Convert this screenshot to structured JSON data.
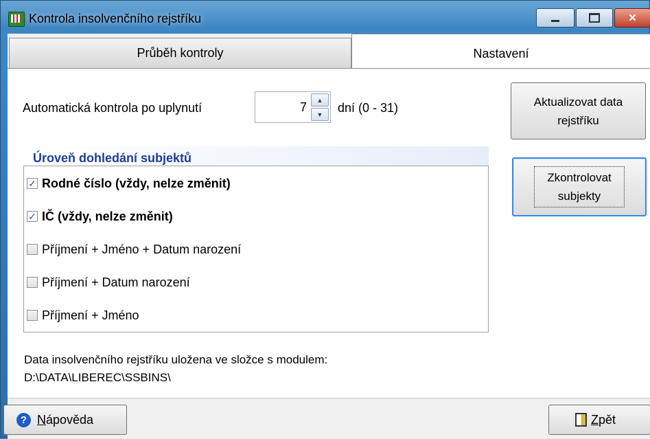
{
  "window": {
    "title": "Kontrola insolvenčního rejstříku",
    "controls": {
      "minimize": "–",
      "maximize": "□",
      "close": "✕"
    }
  },
  "tabs": [
    {
      "label": "Průběh kontroly",
      "active": false
    },
    {
      "label": "Nastavení",
      "active": true
    }
  ],
  "settings": {
    "auto_check_label": "Automatická kontrola po uplynutí",
    "auto_check_value": "7",
    "auto_check_suffix": "dní (0 - 31)",
    "spin_up": "▲",
    "spin_down": "▼"
  },
  "match_level": {
    "header": "Úroveň dohledání subjektů",
    "options": [
      {
        "label": "Rodné číslo (vždy, nelze změnit)",
        "checked": true,
        "bold": true
      },
      {
        "label": "IČ (vždy, nelze změnit)",
        "checked": true,
        "bold": true
      },
      {
        "label": "Příjmení + Jméno + Datum narození",
        "checked": false,
        "bold": false
      },
      {
        "label": "Příjmení + Datum narození",
        "checked": false,
        "bold": false
      },
      {
        "label": "Příjmení + Jméno",
        "checked": false,
        "bold": false
      }
    ]
  },
  "actions": {
    "update_line1": "Aktualizovat data",
    "update_line2": "rejstříku",
    "check_line1": "Zkontrolovat",
    "check_line2": "subjekty"
  },
  "info": {
    "line1": "Data insolvenčního rejstříku uložena ve složce s modulem:",
    "line2": "D:\\DATA\\LIBEREC\\SSBINS\\"
  },
  "footer": {
    "help_accel": "N",
    "help_rest": "ápověda",
    "back_accel": "Z",
    "back_rest": "pět"
  },
  "icons": {
    "app": "app-grid-icon",
    "help": "question-icon",
    "back": "door-exit-icon"
  },
  "colors": {
    "group_header_text": "#1c3f9b",
    "focus_border": "#3c8ad8",
    "checkmark": "#2a53a8"
  }
}
